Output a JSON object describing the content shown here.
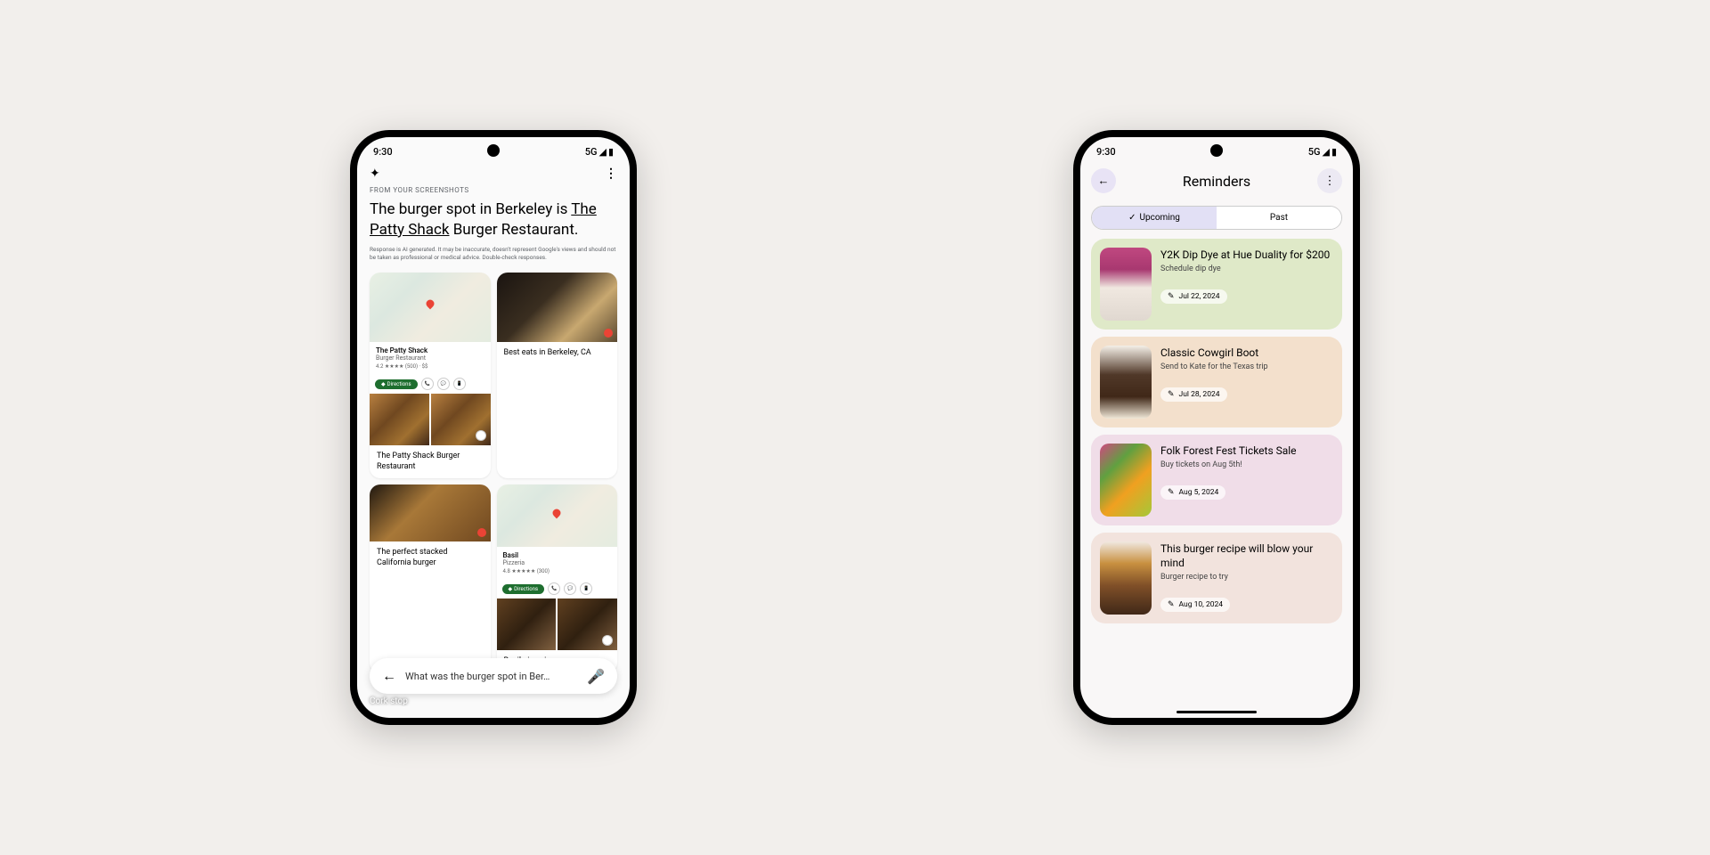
{
  "status": {
    "time": "9:30",
    "network": "5G"
  },
  "phone1": {
    "section_label": "FROM YOUR SCREENSHOTS",
    "headline_pre": "The burger spot in Berkeley is ",
    "headline_link": "The Patty Shack",
    "headline_post": " Burger Restaurant.",
    "disclaimer": "Response is AI generated. It may be inaccurate, doesn't represent Google's views and should not be taken as professional or medical advice. Double-check responses.",
    "place1": {
      "name": "The Patty Shack",
      "type": "Burger Restaurant",
      "rating": "4.2 ★★★★ (500) · $$",
      "directions": "Directions"
    },
    "card_sushi": "Best eats in Berkeley, CA",
    "card_burger": "The Patty Shack Burger Restaurant",
    "place2": {
      "name": "Basil",
      "type": "Pizzeria",
      "rating": "4.8 ★★★★★ (300)",
      "directions": "Directions"
    },
    "card_stacked": "The perfect stacked California burger",
    "card_pizza": "Basil pizzeria",
    "cork": "Cork stop",
    "search": "What was the burger spot in Ber…"
  },
  "phone2": {
    "title": "Reminders",
    "tabs": {
      "upcoming": "Upcoming",
      "past": "Past"
    },
    "reminders": [
      {
        "title": "Y2K Dip Dye at Hue Duality for $200",
        "sub": "Schedule dip dye",
        "date": "Jul 22, 2024"
      },
      {
        "title": "Classic Cowgirl Boot",
        "sub": "Send to Kate for the Texas trip",
        "date": "Jul 28, 2024"
      },
      {
        "title": "Folk Forest Fest Tickets Sale",
        "sub": "Buy tickets on Aug 5th!",
        "date": "Aug 5, 2024"
      },
      {
        "title": "This burger recipe will blow your mind",
        "sub": "Burger recipe to try",
        "date": "Aug 10, 2024"
      }
    ]
  }
}
